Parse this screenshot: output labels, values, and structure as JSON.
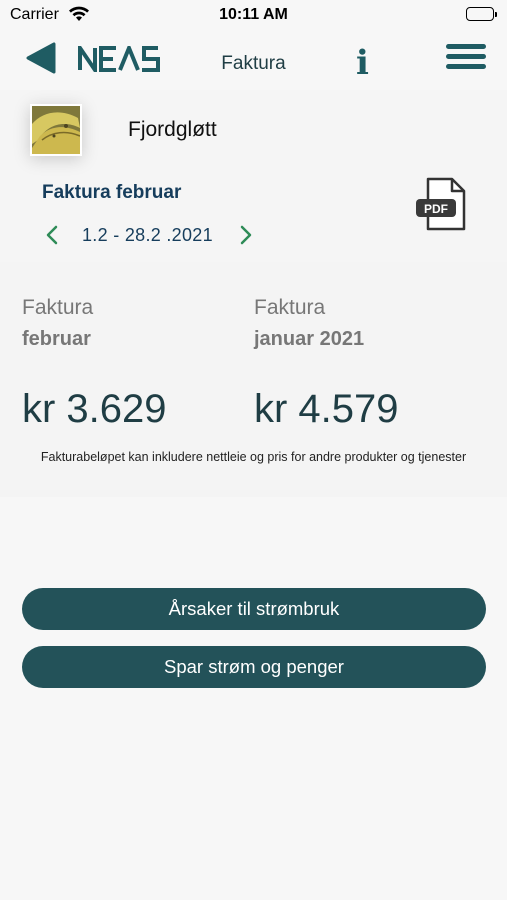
{
  "status_bar": {
    "carrier": "Carrier",
    "time": "10:11 AM"
  },
  "nav": {
    "title": "Faktura",
    "logo_text": "NEAS",
    "info_label": "i"
  },
  "location": {
    "name": "Fjordgløtt"
  },
  "invoice": {
    "label": "Faktura februar",
    "period": "1.2 - 28.2 .2021",
    "pdf_label": "PDF"
  },
  "summary": {
    "current": {
      "label": "Faktura",
      "month": "februar",
      "amount": "kr 3.629"
    },
    "previous": {
      "label": "Faktura",
      "month": "januar 2021",
      "amount": "kr 4.579"
    },
    "disclaimer": "Fakturabeløpet kan inkludere nettleie og pris for andre produkter og tjenester"
  },
  "actions": {
    "causes_label": "Årsaker til strømbruk",
    "save_label": "Spar strøm og penger"
  },
  "colors": {
    "primary": "#235259",
    "accent_green": "#2e8b57",
    "title_blue": "#163d5c"
  }
}
